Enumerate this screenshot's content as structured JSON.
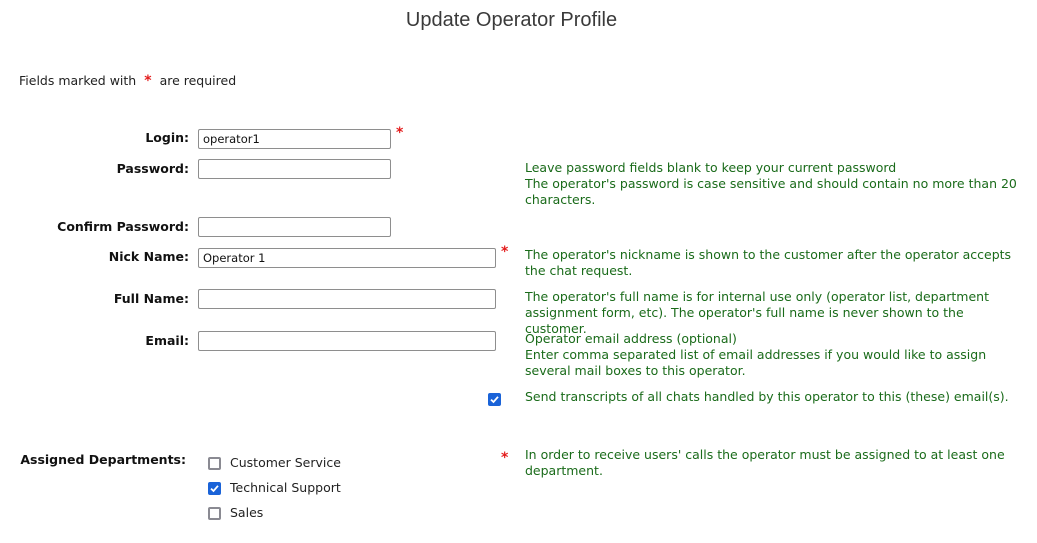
{
  "page": {
    "title": "Update Operator Profile",
    "required_note": {
      "prefix": "Fields marked with",
      "marker": "*",
      "suffix": "are required"
    }
  },
  "form": {
    "login": {
      "label": "Login:",
      "value": "operator1",
      "required": true
    },
    "password": {
      "label": "Password:",
      "value": ""
    },
    "confirm_password": {
      "label": "Confirm Password:",
      "value": ""
    },
    "nick_name": {
      "label": "Nick Name:",
      "value": "Operator 1",
      "required": true
    },
    "full_name": {
      "label": "Full Name:",
      "value": ""
    },
    "email": {
      "label": "Email:",
      "value": ""
    },
    "send_transcripts": {
      "checked": true,
      "label": "Send transcripts of all chats handled by this operator to this (these) email(s)."
    },
    "departments": {
      "label": "Assigned Departments:",
      "required": true,
      "items": [
        {
          "label": "Customer Service",
          "checked": false
        },
        {
          "label": "Technical Support",
          "checked": true
        },
        {
          "label": "Sales",
          "checked": false
        }
      ]
    }
  },
  "help": {
    "password_line1": "Leave password fields blank to keep your current password",
    "password_line2": "The operator's password is case sensitive and should contain no more than 20 characters.",
    "nick_name": "The operator's nickname is shown to the customer after the operator accepts the chat request.",
    "full_name": "The operator's full name is for internal use only (operator list, department assignment form, etc). The operator's full name is never shown to the customer.",
    "email_line1": "Operator email address (optional)",
    "email_line2": "Enter comma separated list of email addresses if you would like to assign several mail boxes to this operator.",
    "departments": "In order to receive users' calls the operator must be assigned to at least one department."
  },
  "colors": {
    "help_text": "#1a6b1a",
    "required_star": "#e31b1b",
    "checkbox_accent": "#1a63d8"
  }
}
